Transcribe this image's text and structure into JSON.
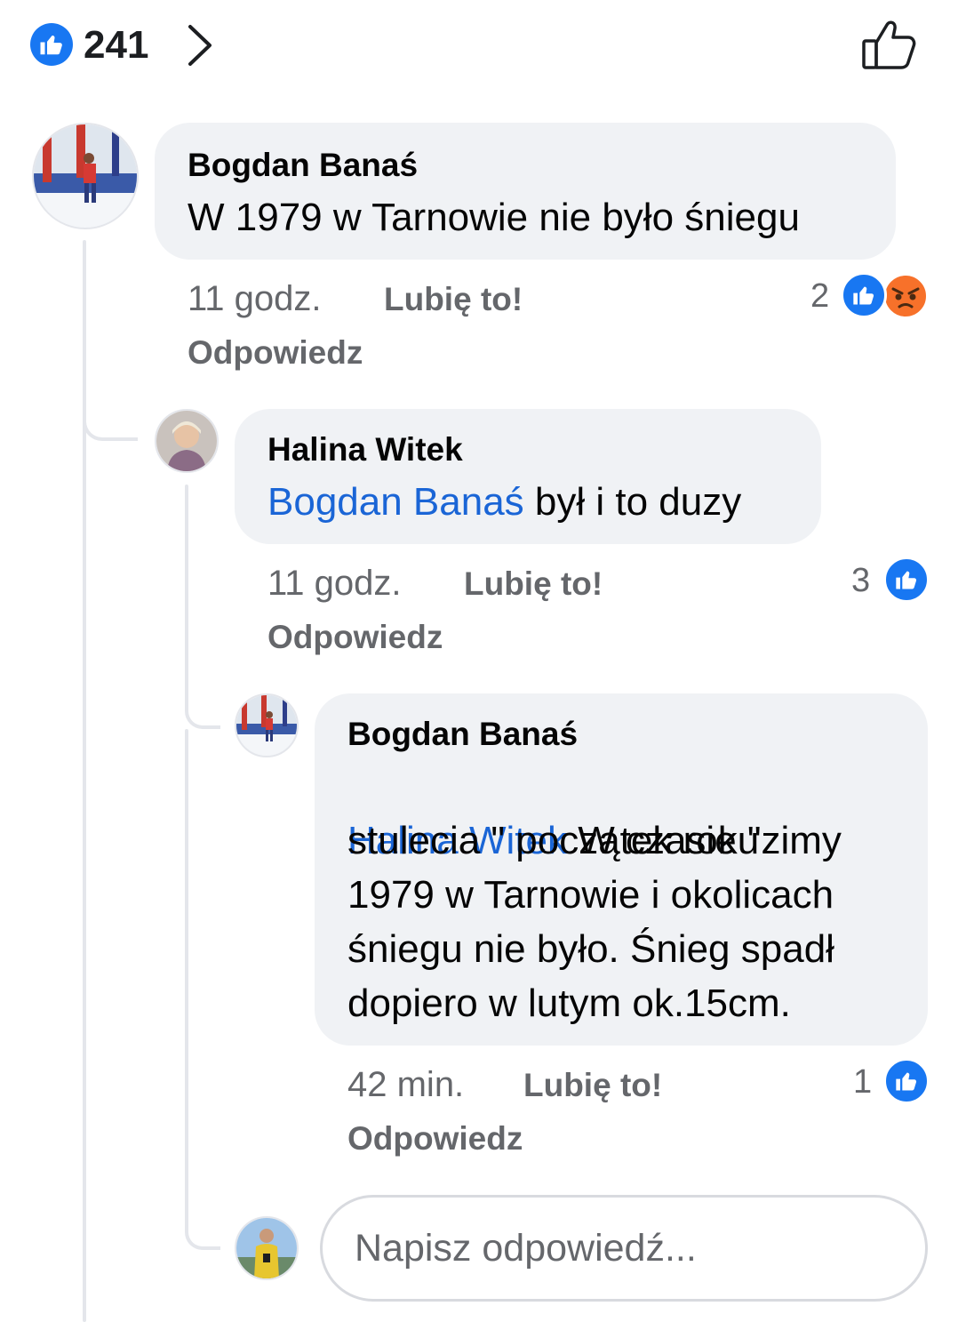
{
  "header": {
    "reaction_count": "241"
  },
  "comments": [
    {
      "author": "Bogdan Banaś",
      "text": "W 1979 w Tarnowie nie było śniegu",
      "time": "11 godz.",
      "like_label": "Lubię to!",
      "reply_label": "Odpowiedz",
      "reaction_count": "2"
    },
    {
      "author": "Halina Witek",
      "mention": "Bogdan Banaś",
      "text": " był i to duzy",
      "time": "11 godz.",
      "like_label": "Lubię to!",
      "reply_label": "Odpowiedz",
      "reaction_count": "3"
    },
    {
      "author": "Bogdan Banaś",
      "mention": "Halina Witek",
      "text_line1": " W czasie \"zimy",
      "text_line2": "stulecia \" początek roku",
      "text_line3": "1979 w Tarnowie i okolicach",
      "text_line4": "śniegu nie było. Śnieg spadł",
      "text_line5": "dopiero w lutym ok.15cm.",
      "time": "42 min.",
      "like_label": "Lubię to!",
      "reply_label": "Odpowiedz",
      "reaction_count": "1"
    }
  ],
  "reply_input": {
    "placeholder": "Napisz odpowiedź..."
  },
  "colors": {
    "like_blue": "#1877f2",
    "angry_orange": "#f7712a",
    "mention_blue": "#1a65d6",
    "bubble_grey": "#f0f2f5"
  },
  "icons": [
    "like-reaction-icon",
    "chevron-right-icon",
    "thumbs-up-outline-icon",
    "angry-reaction-icon"
  ]
}
